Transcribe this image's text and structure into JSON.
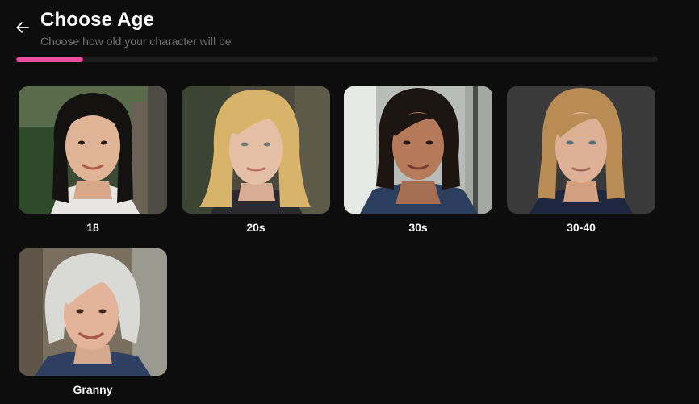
{
  "header": {
    "title": "Choose Age",
    "subtitle": "Choose how old your character will be"
  },
  "progress": {
    "fraction": 0.104
  },
  "colors": {
    "background": "#0d0d0d",
    "accent": "#ec4f9f",
    "track": "#1e1e1e",
    "subtitle": "#6f6f6f"
  },
  "options": [
    {
      "label": "18"
    },
    {
      "label": "20s"
    },
    {
      "label": "30s"
    },
    {
      "label": "30-40"
    },
    {
      "label": "Granny"
    }
  ]
}
